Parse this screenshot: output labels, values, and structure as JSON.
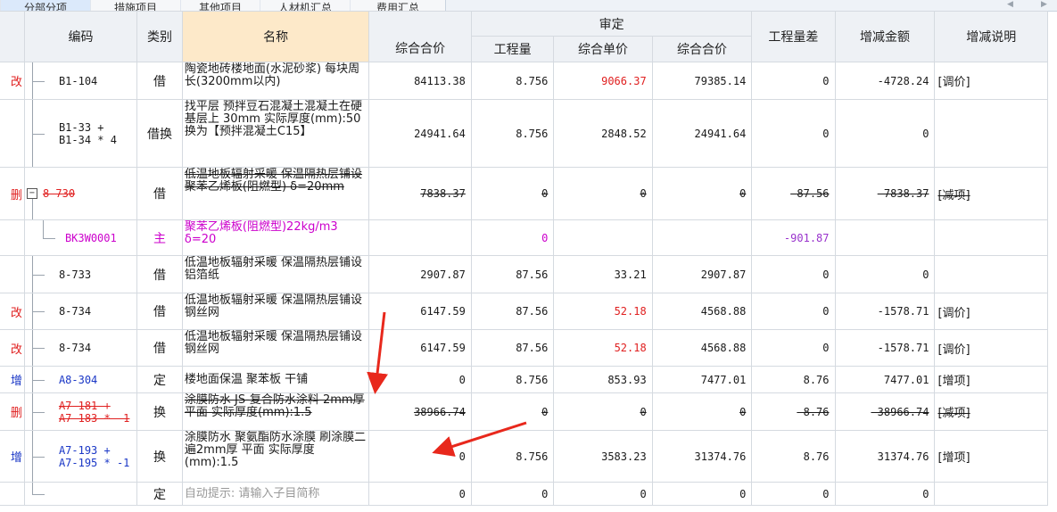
{
  "tabs": [
    {
      "label": "分部分项"
    },
    {
      "label": "措施项目"
    },
    {
      "label": "其他项目"
    },
    {
      "label": "人材机汇总"
    },
    {
      "label": "费用汇总"
    }
  ],
  "header": {
    "col_code": "编码",
    "col_cat": "类别",
    "col_name": "名称",
    "group_review": "审定",
    "col_sent_total": "综合合价",
    "col_qty": "工程量",
    "col_unit_price": "综合单价",
    "col_review_total": "综合合价",
    "col_qty_diff": "工程量差",
    "col_amount_diff": "增减金额",
    "col_note": "增减说明"
  },
  "rows": [
    {
      "flag": "改",
      "code": "B1-104",
      "cat": "借",
      "name": "陶瓷地砖楼地面(水泥砂浆) 每块周长(3200mm以内)",
      "sent_total": "84113.38",
      "qty": "8.756",
      "unit_price": "9066.37",
      "review_total": "79385.14",
      "qty_diff": "0",
      "amount_diff": "-4728.24",
      "note": "[调价]"
    },
    {
      "flag": "",
      "code": "B1-33 +\nB1-34 * 4",
      "cat": "借换",
      "name": "找平层 预拌豆石混凝土混凝土在硬基层上 30mm 实际厚度(mm):50 换为【预拌混凝土C15】",
      "sent_total": "24941.64",
      "qty": "8.756",
      "unit_price": "2848.52",
      "review_total": "24941.64",
      "qty_diff": "0",
      "amount_diff": "0",
      "note": ""
    },
    {
      "flag": "删",
      "code": "8-730",
      "cat": "借",
      "name": "低温地板辐射采暖 保温隔热层铺设 聚苯乙烯板(阻燃型) δ=20mm",
      "sent_total": "7838.37",
      "qty": "0",
      "unit_price": "0",
      "review_total": "0",
      "qty_diff": "-87.56",
      "amount_diff": "-7838.37",
      "note": "[减项]"
    },
    {
      "flag": "",
      "code": "BK3W0001",
      "cat": "主",
      "name": "聚苯乙烯板(阻燃型)22kg/m3 δ=20",
      "sent_total": "",
      "qty": "0",
      "unit_price": "",
      "review_total": "",
      "qty_diff": "-901.87",
      "amount_diff": "",
      "note": ""
    },
    {
      "flag": "",
      "code": "8-733",
      "cat": "借",
      "name": "低温地板辐射采暖 保温隔热层铺设 铝箔纸",
      "sent_total": "2907.87",
      "qty": "87.56",
      "unit_price": "33.21",
      "review_total": "2907.87",
      "qty_diff": "0",
      "amount_diff": "0",
      "note": ""
    },
    {
      "flag": "改",
      "code": "8-734",
      "cat": "借",
      "name": "低温地板辐射采暖 保温隔热层铺设 钢丝网",
      "sent_total": "6147.59",
      "qty": "87.56",
      "unit_price": "52.18",
      "review_total": "4568.88",
      "qty_diff": "0",
      "amount_diff": "-1578.71",
      "note": "[调价]"
    },
    {
      "flag": "改",
      "code": "8-734",
      "cat": "借",
      "name": "低温地板辐射采暖 保温隔热层铺设 钢丝网",
      "sent_total": "6147.59",
      "qty": "87.56",
      "unit_price": "52.18",
      "review_total": "4568.88",
      "qty_diff": "0",
      "amount_diff": "-1578.71",
      "note": "[调价]"
    },
    {
      "flag": "增",
      "code": "A8-304",
      "cat": "定",
      "name": "楼地面保温 聚苯板 干铺",
      "sent_total": "0",
      "qty": "8.756",
      "unit_price": "853.93",
      "review_total": "7477.01",
      "qty_diff": "8.76",
      "amount_diff": "7477.01",
      "note": "[增项]"
    },
    {
      "flag": "删",
      "code": "A7-181 +\nA7-183 * -1",
      "cat": "换",
      "name": "涂膜防水 JS-复合防水涂料 2mm厚 平面 实际厚度(mm):1.5",
      "sent_total": "38966.74",
      "qty": "0",
      "unit_price": "0",
      "review_total": "0",
      "qty_diff": "-8.76",
      "amount_diff": "-38966.74",
      "note": "[减项]"
    },
    {
      "flag": "增",
      "code": "A7-193 +\nA7-195 * -1",
      "cat": "换",
      "name": "涂膜防水 聚氨酯防水涂膜 刷涂膜二遍2mm厚 平面 实际厚度(mm):1.5",
      "sent_total": "0",
      "qty": "8.756",
      "unit_price": "3583.23",
      "review_total": "31374.76",
      "qty_diff": "8.76",
      "amount_diff": "31374.76",
      "note": "[增项]"
    },
    {
      "flag": "",
      "code": "",
      "cat": "定",
      "name": "自动提示: 请输入子目简称",
      "sent_total": "0",
      "qty": "0",
      "unit_price": "0",
      "review_total": "0",
      "qty_diff": "0",
      "amount_diff": "0",
      "note": ""
    }
  ],
  "colors": {
    "red": "#e02020",
    "blue": "#1a37c6",
    "magenta": "#cc00cc",
    "purple": "#9933cc",
    "annotation_arrow": "#e8281c"
  },
  "icons": {
    "expand": "minus-box-icon",
    "scroll_left": "triangle-left-icon",
    "scroll_right": "triangle-right-icon"
  }
}
